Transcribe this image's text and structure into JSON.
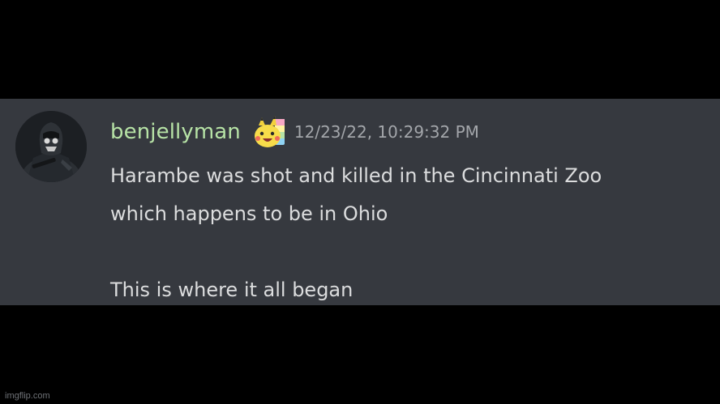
{
  "message": {
    "username": "benjellyman",
    "username_color": "#b7e3a6",
    "role_icon": "pikachu-emoji-icon",
    "avatar_icon": "soldier-avatar-icon",
    "timestamp": "12/23/22, 10:29:32 PM",
    "lines": [
      "Harambe was shot and killed in the Cincinnati Zoo",
      "which happens to be in Ohio",
      "",
      "This is where it all began"
    ]
  },
  "background_color": "#36393f",
  "watermark": "imgflip.com"
}
